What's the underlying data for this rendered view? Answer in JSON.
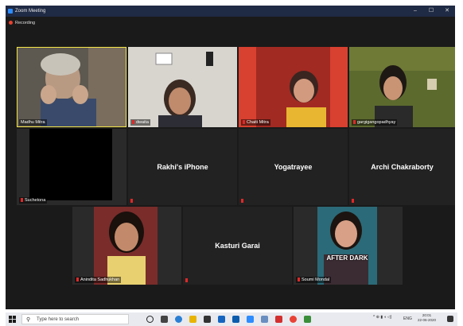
{
  "window": {
    "title": "Zoom Meeting",
    "minimize": "–",
    "maximize": "☐",
    "close": "✕"
  },
  "recording": {
    "label": "Recording"
  },
  "participants": {
    "row1": [
      {
        "name": "Madhu Mitra"
      },
      {
        "name": "dwaita"
      },
      {
        "name": "Chaiti Mitra"
      },
      {
        "name": "gargigangopadhyay"
      }
    ],
    "row2": [
      {
        "name": "Suchetona"
      },
      {
        "big": "Rakhi's iPhone"
      },
      {
        "big": "Yogatrayee"
      },
      {
        "big": "Archi Chakraborty"
      }
    ],
    "row3": [
      {
        "name": "Anindita Sadhukhan"
      },
      {
        "big": "Kasturi Garai"
      },
      {
        "name": "Soumi Mondal",
        "overlay": "AFTER DARK"
      }
    ]
  },
  "taskbar": {
    "search_placeholder": "Type here to search",
    "tray": {
      "lang": "ENG",
      "time": "20:01",
      "date": "22-06-2020"
    }
  },
  "colors": {
    "active_speaker": "#f5e64a",
    "mic_muted": "#e02828",
    "title_bar": "#1f2a44"
  }
}
